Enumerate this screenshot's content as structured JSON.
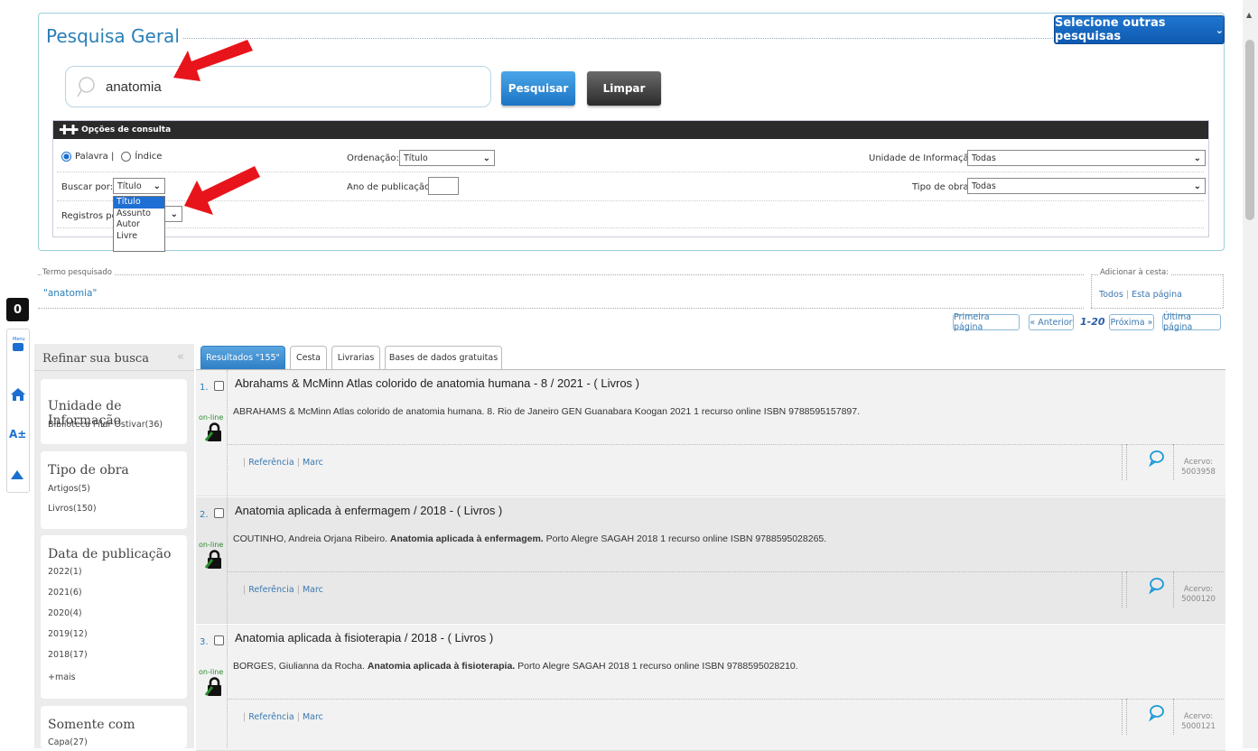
{
  "header": {
    "legend": "Pesquisa Geral",
    "other_searches_label": "Selecione outras pesquisas"
  },
  "search": {
    "value": "anatomia",
    "submit_label": "Pesquisar",
    "clear_label": "Limpar"
  },
  "options": {
    "header_label": "Opções de consulta",
    "radio_palavra": "Palavra |",
    "radio_indice": "Índice",
    "ordenacao_label": "Ordenação:",
    "ordenacao_value": "Título",
    "unidade_label": "Unidade de Informação:",
    "unidade_value": "Todas",
    "buscar_label": "Buscar por:",
    "buscar_value": "Título",
    "ano_label": "Ano de publicação:",
    "tipo_label": "Tipo de obra:",
    "tipo_value": "Todas",
    "registros_label": "Registros por",
    "dropdown_options": [
      "Título",
      "Assunto",
      "Autor",
      "Livre"
    ]
  },
  "term": {
    "legend": "Termo pesquisado",
    "value": "\"anatomia\""
  },
  "basket": {
    "legend": "Adicionar à cesta:",
    "all_label": "Todos",
    "page_label": "Esta página"
  },
  "pagination": {
    "first": "Primeira página",
    "prev": "« Anterior",
    "range": "1-20",
    "next": "Próxima »",
    "last": "Última página"
  },
  "sidebar": {
    "title": "Refinar sua busca",
    "facets": [
      {
        "title": "Unidade de Informação",
        "items": [
          "Biblioteca Pilar Ostivar(36)"
        ]
      },
      {
        "title": "Tipo de obra",
        "items": [
          "Artigos(5)",
          "Livros(150)"
        ]
      },
      {
        "title": "Data de publicação",
        "items": [
          "2022(1)",
          "2021(6)",
          "2020(4)",
          "2019(12)",
          "2018(17)",
          "+mais"
        ]
      },
      {
        "title": "Somente com",
        "items": [
          "Capa(27)"
        ]
      }
    ]
  },
  "tabs": [
    "Resultados \"155\"",
    "Cesta",
    "Livrarias",
    "Bases de dados gratuitas"
  ],
  "results": [
    {
      "num": "1.",
      "title": "Abrahams & McMinn Atlas colorido de anatomia humana - 8 / 2021 - ( Livros )",
      "desc_pre": "ABRAHAMS & McMinn Atlas colorido de anatomia humana. 8. Rio de Janeiro GEN Guanabara Koogan 2021 1 recurso online ISBN 9788595157897.",
      "desc_bold": "",
      "desc_post": "",
      "acervo_label": "Acervo:",
      "acervo": "5003958"
    },
    {
      "num": "2.",
      "title": "Anatomia aplicada à enfermagem / 2018 - ( Livros )",
      "desc_pre": "COUTINHO, Andreia Orjana Ribeiro. ",
      "desc_bold": "Anatomia aplicada à enfermagem.",
      "desc_post": " Porto Alegre SAGAH 2018 1 recurso online ISBN 9788595028265.",
      "acervo_label": "Acervo:",
      "acervo": "5000120"
    },
    {
      "num": "3.",
      "title": "Anatomia aplicada à fisioterapia / 2018 - ( Livros )",
      "desc_pre": "BORGES, Giulianna da Rocha. ",
      "desc_bold": "Anatomia aplicada à fisioterapia.",
      "desc_post": " Porto Alegre SAGAH 2018 1 recurso online ISBN 9788595028210.",
      "acervo_label": "Acervo:",
      "acervo": "5000121"
    }
  ],
  "result_links": {
    "ref": "Referência",
    "marc": "Marc",
    "online": "on-line"
  },
  "side_tools": {
    "contrast": "0",
    "font": "A±"
  },
  "colors": {
    "accent": "#1a6fd0",
    "arrow": "#e8141b",
    "header_dark": "#2b2b2b"
  }
}
